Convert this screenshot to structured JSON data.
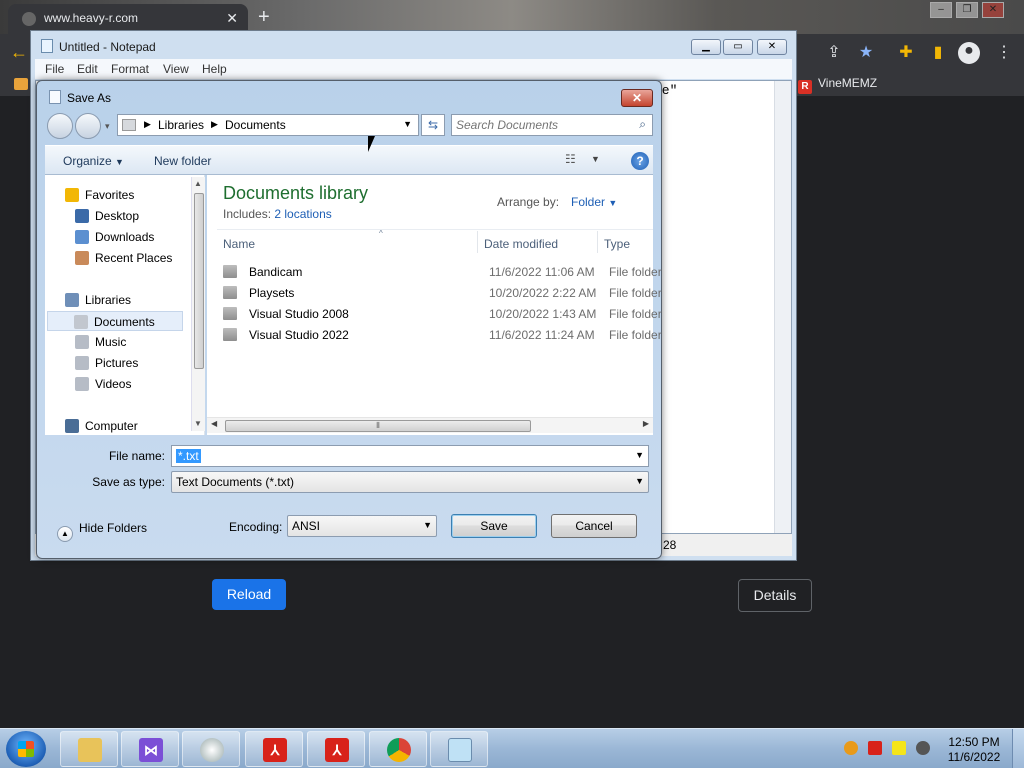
{
  "browser": {
    "tab_title": "www.heavy-r.com",
    "tab_close": "✕",
    "new_tab": "+",
    "bookmark": "VineMEMZ",
    "reload_label": "Reload",
    "details_label": "Details"
  },
  "notepad": {
    "title": "Untitled - Notepad",
    "menus": [
      "File",
      "Edit",
      "Format",
      "View",
      "Help"
    ],
    "edit_text": "te\"",
    "status_text": "28"
  },
  "dialog": {
    "title": "Save As",
    "close": "✕",
    "breadcrumb": [
      "Libraries",
      "Documents"
    ],
    "search_placeholder": "Search Documents",
    "organize_label": "Organize",
    "new_folder_label": "New folder",
    "help_label": "?",
    "nav": {
      "favorites_label": "Favorites",
      "favorites": [
        "Desktop",
        "Downloads",
        "Recent Places"
      ],
      "libraries_label": "Libraries",
      "libraries": [
        "Documents",
        "Music",
        "Pictures",
        "Videos"
      ],
      "computer_label": "Computer"
    },
    "library_title": "Documents library",
    "includes_label": "Includes:",
    "includes_link": "2 locations",
    "arrange_label": "Arrange by:",
    "arrange_value": "Folder",
    "columns": {
      "name": "Name",
      "date": "Date modified",
      "type": "Type"
    },
    "files": [
      {
        "name": "Bandicam",
        "date": "11/6/2022 11:06 AM",
        "type": "File folder"
      },
      {
        "name": "Playsets",
        "date": "10/20/2022 2:22 AM",
        "type": "File folder"
      },
      {
        "name": "Visual Studio 2008",
        "date": "10/20/2022 1:43 AM",
        "type": "File folder"
      },
      {
        "name": "Visual Studio 2022",
        "date": "11/6/2022 11:24 AM",
        "type": "File folder"
      }
    ],
    "file_name_label": "File name:",
    "file_name_value": "*.txt",
    "save_type_label": "Save as type:",
    "save_type_value": "Text Documents (*.txt)",
    "hide_folders_label": "Hide Folders",
    "encoding_label": "Encoding:",
    "encoding_value": "ANSI",
    "save_label": "Save",
    "cancel_label": "Cancel"
  },
  "taskbar": {
    "apps": [
      "explorer-icon",
      "visual-studio-icon",
      "game-icon",
      "acrobat-icon",
      "acrobat-icon",
      "chrome-icon",
      "notepad-icon"
    ],
    "clock_time": "12:50 PM",
    "clock_date": "11/6/2022"
  },
  "colors": {
    "accent_blue": "#1a73e8",
    "library_title_green": "#1e6e2f",
    "link_blue": "#1e5fb5",
    "selection_blue": "#3399ff"
  }
}
